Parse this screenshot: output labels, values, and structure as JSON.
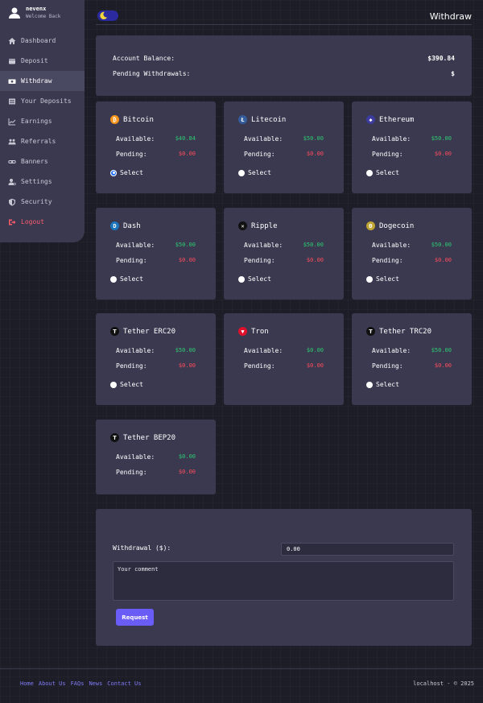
{
  "user": {
    "name": "nevenx",
    "welcome": "Welcome Back"
  },
  "nav": [
    {
      "label": "Dashboard",
      "icon": "home-icon"
    },
    {
      "label": "Deposit",
      "icon": "wallet-icon"
    },
    {
      "label": "Withdraw",
      "icon": "money-icon",
      "active": true
    },
    {
      "label": "Your Deposits",
      "icon": "list-icon"
    },
    {
      "label": "Earnings",
      "icon": "chart-icon"
    },
    {
      "label": "Referrals",
      "icon": "users-icon"
    },
    {
      "label": "Banners",
      "icon": "link-icon"
    },
    {
      "label": "Settings",
      "icon": "user-gear-icon"
    },
    {
      "label": "Security",
      "icon": "shield-icon"
    },
    {
      "label": "Logout",
      "icon": "logout-icon"
    }
  ],
  "header": {
    "title": "Withdraw"
  },
  "balance": {
    "account_label": "Account Balance:",
    "account_value": "$390.84",
    "pending_label": "Pending Withdrawals:",
    "pending_value": "$"
  },
  "labels": {
    "available": "Available:",
    "pending": "Pending:",
    "select": "Select"
  },
  "wallets": [
    {
      "name": "Bitcoin",
      "available": "$40.84",
      "pending": "$0.00",
      "color": "#f7931a",
      "glyph": "₿",
      "selectable": true,
      "selected": true
    },
    {
      "name": "Litecoin",
      "available": "$50.00",
      "pending": "$0.00",
      "color": "#345d9d",
      "glyph": "Ł",
      "selectable": true
    },
    {
      "name": "Ethereum",
      "available": "$50.00",
      "pending": "$0.00",
      "color": "#3c3c9e",
      "glyph": "◆",
      "selectable": true
    },
    {
      "name": "Dash",
      "available": "$50.00",
      "pending": "$0.00",
      "color": "#1c75bc",
      "glyph": "D",
      "selectable": true
    },
    {
      "name": "Ripple",
      "available": "$50.00",
      "pending": "$0.00",
      "color": "#111111",
      "glyph": "✕",
      "selectable": true
    },
    {
      "name": "Dogecoin",
      "available": "$50.00",
      "pending": "$0.00",
      "color": "#c2a633",
      "glyph": "Ð",
      "selectable": true
    },
    {
      "name": "Tether ERC20",
      "available": "$50.00",
      "pending": "$0.00",
      "color": "#111111",
      "glyph": "₮",
      "selectable": true
    },
    {
      "name": "Tron",
      "available": "$0.00",
      "pending": "$0.00",
      "color": "#e0102a",
      "glyph": "▼",
      "selectable": false
    },
    {
      "name": "Tether TRC20",
      "available": "$50.00",
      "pending": "$0.00",
      "color": "#111111",
      "glyph": "₮",
      "selectable": true
    },
    {
      "name": "Tether BEP20",
      "available": "$0.00",
      "pending": "$0.00",
      "color": "#111111",
      "glyph": "₮",
      "selectable": false
    }
  ],
  "form": {
    "withdrawal_label": "Withdrawal ($):",
    "amount_value": "0.00",
    "comment_placeholder": "Your comment",
    "request_label": "Request"
  },
  "footer": {
    "links": [
      "Home",
      "About Us",
      "FAQs",
      "News",
      "Contact Us"
    ],
    "copyright": "localhost - © 2025"
  },
  "colors": {
    "accent": "#6a5cf6",
    "available": "#2ecc71",
    "pending": "#ff4c5c",
    "card": "#3a3950"
  }
}
